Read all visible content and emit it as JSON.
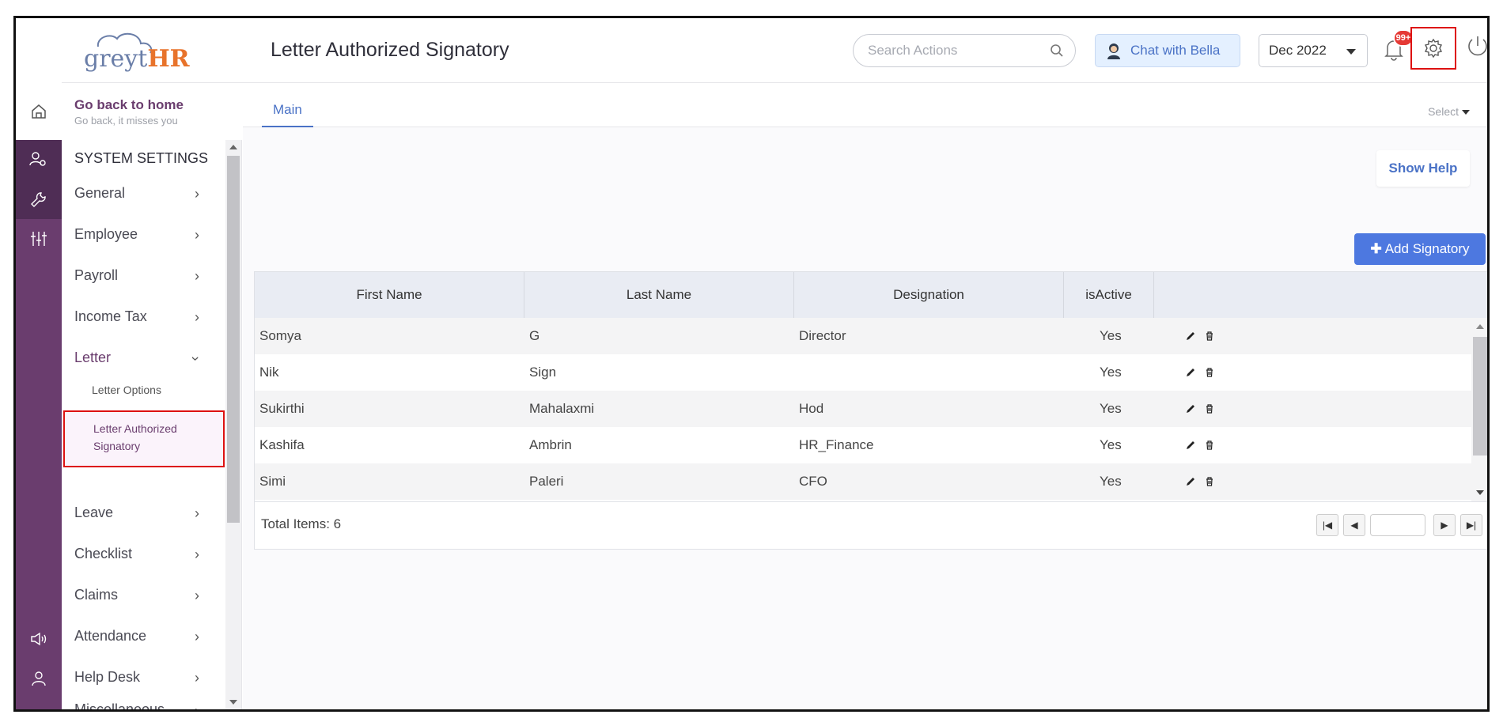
{
  "app": {
    "logo_text_grey": "greyt",
    "logo_text_hr": "HR",
    "page_title": "Letter Authorized Signatory"
  },
  "header": {
    "search_placeholder": "Search Actions",
    "bella_label": "Chat with Bella",
    "period": "Dec 2022",
    "notification_badge": "99+"
  },
  "home": {
    "title": "Go back to home",
    "subtitle": "Go back, it misses you"
  },
  "sidebar": {
    "section_title": "SYSTEM SETTINGS",
    "items": [
      {
        "label": "General"
      },
      {
        "label": "Employee"
      },
      {
        "label": "Payroll"
      },
      {
        "label": "Income Tax"
      },
      {
        "label": "Letter"
      },
      {
        "label": "Leave"
      },
      {
        "label": "Checklist"
      },
      {
        "label": "Claims"
      },
      {
        "label": "Attendance"
      },
      {
        "label": "Help Desk"
      },
      {
        "label": "Miscellaneous"
      }
    ],
    "letter_sub": {
      "options": "Letter Options",
      "authorized_line1": "Letter Authorized",
      "authorized_line2": "Signatory"
    }
  },
  "main": {
    "tab_label": "Main",
    "select_label": "Select",
    "show_help": "Show Help",
    "add_signatory": "Add Signatory",
    "columns": [
      "First Name",
      "Last Name",
      "Designation",
      "isActive"
    ],
    "rows": [
      {
        "first": "Somya",
        "last": "G",
        "designation": "Director",
        "active": "Yes"
      },
      {
        "first": "Nik",
        "last": "Sign",
        "designation": "",
        "active": "Yes"
      },
      {
        "first": "Sukirthi",
        "last": "Mahalaxmi",
        "designation": "Hod",
        "active": "Yes"
      },
      {
        "first": "Kashifa",
        "last": "Ambrin",
        "designation": "HR_Finance",
        "active": "Yes"
      },
      {
        "first": "Simi",
        "last": "Paleri",
        "designation": "CFO",
        "active": "Yes"
      }
    ],
    "total_items": "Total Items: 6"
  },
  "colors": {
    "brand_purple": "#6a3d6e",
    "accent_blue": "#4d78e0",
    "highlight_red": "#dd1111"
  }
}
